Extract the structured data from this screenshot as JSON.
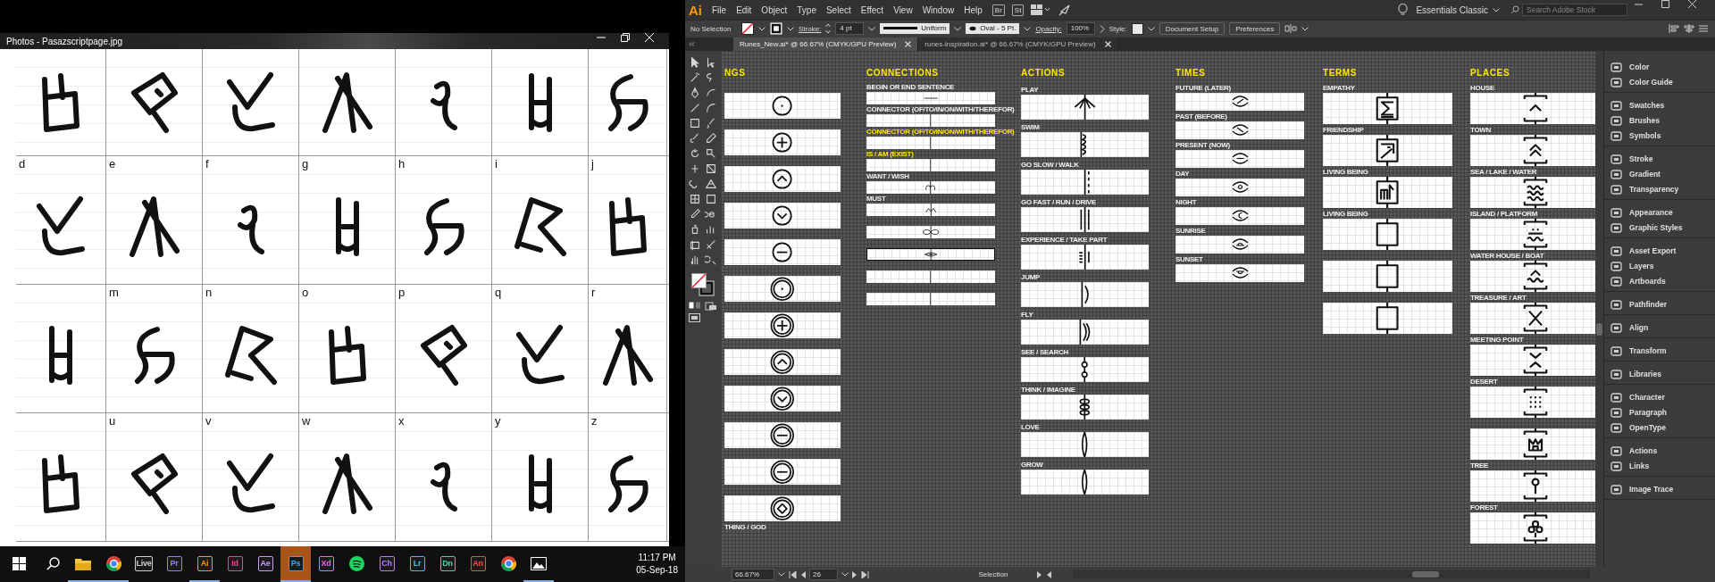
{
  "photos": {
    "title": "Photos - Pasazscriptpage.jpg",
    "letter_rows": [
      {
        "letters": [
          "d",
          "e",
          "f",
          "g",
          "h",
          "i",
          "j"
        ]
      },
      {
        "letters": [
          "m",
          "n",
          "o",
          "p",
          "q",
          "r"
        ]
      },
      {
        "letters": [
          "u",
          "v",
          "w",
          "x",
          "y",
          "z"
        ]
      }
    ]
  },
  "taskbar": {
    "items": [
      {
        "kind": "start",
        "open": false,
        "selected": false
      },
      {
        "kind": "search",
        "open": false,
        "selected": false
      },
      {
        "kind": "folder",
        "open": true,
        "selected": false
      },
      {
        "kind": "chrome",
        "open": true,
        "selected": false
      },
      {
        "kind": "tile",
        "label": "Live",
        "color": "#d0d0d0",
        "open": false,
        "selected": false
      },
      {
        "kind": "tile",
        "label": "Pr",
        "color": "#9a7cff",
        "open": false,
        "selected": false
      },
      {
        "kind": "tile",
        "label": "Ai",
        "color": "#ff9a00",
        "open": true,
        "selected": false
      },
      {
        "kind": "tile",
        "label": "Id",
        "color": "#ff3d93",
        "open": false,
        "selected": false
      },
      {
        "kind": "tile",
        "label": "Ae",
        "color": "#c99bff",
        "open": false,
        "selected": false
      },
      {
        "kind": "tile",
        "label": "Ps",
        "color": "#31a8ff",
        "open": true,
        "selected": true
      },
      {
        "kind": "tile",
        "label": "Xd",
        "color": "#ff61f6",
        "open": false,
        "selected": false
      },
      {
        "kind": "spotify",
        "open": false,
        "selected": false
      },
      {
        "kind": "tile",
        "label": "Ch",
        "color": "#b57cff",
        "open": false,
        "selected": false
      },
      {
        "kind": "tile",
        "label": "Lr",
        "color": "#31c5ff",
        "open": false,
        "selected": false
      },
      {
        "kind": "tile",
        "label": "Dn",
        "color": "#3fd6a6",
        "open": false,
        "selected": false
      },
      {
        "kind": "tile",
        "label": "An",
        "color": "#ff4a3d",
        "open": false,
        "selected": false
      },
      {
        "kind": "chrome",
        "open": false,
        "selected": false
      },
      {
        "kind": "photos",
        "open": true,
        "selected": false
      }
    ],
    "time": "11:17 PM",
    "date": "05-Sep-18"
  },
  "illustrator": {
    "logo": "Ai",
    "menu": [
      "File",
      "Edit",
      "Object",
      "Type",
      "Select",
      "Effect",
      "View",
      "Window",
      "Help"
    ],
    "bridge": "Br",
    "stock": "St",
    "workspace": "Essentials Classic",
    "search": {
      "placeholder": "Search Adobe Stock"
    },
    "control_bar": {
      "selection": "No Selection",
      "stroke_label": "Stroke:",
      "stroke_weight": "4 pt",
      "profile": "Uniform",
      "brush": "Oval - 5 Pt.",
      "opacity_label": "Opacity:",
      "opacity": "100%",
      "style_label": "Style:",
      "buttons": [
        "Document Setup",
        "Preferences"
      ]
    },
    "tabs": [
      {
        "title": "Runes_New.ai* @ 66.67% (CMYK/GPU Preview)",
        "selected": true
      },
      {
        "title": "runes-inspiration.ai* @ 66.67% (CMYK/GPU Preview)",
        "selected": false
      }
    ],
    "columns": [
      {
        "heading": "NGS",
        "rows": [
          {
            "kind": "ring-dot"
          },
          {
            "kind": "ring-plus"
          },
          {
            "kind": "ring-up"
          },
          {
            "kind": "ring-down"
          },
          {
            "kind": "ring-minus"
          },
          {
            "kind": "double-ring-dot"
          },
          {
            "kind": "double-ring-plus"
          },
          {
            "kind": "double-ring-up"
          },
          {
            "kind": "double-ring-down"
          },
          {
            "kind": "double-ring-minus"
          },
          {
            "kind": "double-ring-minus"
          },
          {
            "kind": "double-ring-diamond"
          },
          {
            "label": "THING / GOD"
          }
        ]
      },
      {
        "heading": "CONNECTIONS",
        "rows": [
          {
            "label": "BEGIN OR END SENTENCE",
            "kind": "bar",
            "highlighted": false,
            "selected": false
          },
          {
            "label": "CONNECTOR (OF/TO/IN/ON/WITH/THEREFOR)",
            "kind": "stem",
            "highlighted": false,
            "selected": false
          },
          {
            "label": "CONNECTOR (OF/TO/IN/ON/WITH/THEREFOR)",
            "kind": "stem",
            "highlighted": true,
            "selected": false
          },
          {
            "label": "IS / AM (EXIST)",
            "kind": "stem",
            "highlighted": true,
            "selected": false
          },
          {
            "label": "WANT / WISH",
            "kind": "want",
            "highlighted": false,
            "selected": false
          },
          {
            "label": "MUST",
            "kind": "must",
            "highlighted": false,
            "selected": false
          },
          {
            "kind": "bow",
            "selected": false
          },
          {
            "kind": "eye-stem",
            "selected": true
          },
          {
            "kind": "stem",
            "selected": false
          },
          {
            "kind": "stem",
            "selected": false
          }
        ]
      },
      {
        "heading": "ACTIONS",
        "rows": [
          {
            "label": "PLAY",
            "kind": "play"
          },
          {
            "label": "SWIM",
            "kind": "wave"
          },
          {
            "label": "GO SLOW / WALK",
            "kind": "dashed"
          },
          {
            "label": "GO FAST / RUN / DRIVE",
            "kind": "triple"
          },
          {
            "label": "EXPERIENCE / TAKE PART",
            "kind": "bars"
          },
          {
            "label": "JUMP",
            "kind": "paren"
          },
          {
            "label": "FLY",
            "kind": "dparen"
          },
          {
            "label": "SEE / SEARCH",
            "kind": "beads"
          },
          {
            "label": "THINK / IMAGINE",
            "kind": "ovals"
          },
          {
            "label": "LOVE",
            "kind": "lens"
          },
          {
            "label": "GROW",
            "kind": "lens"
          }
        ]
      },
      {
        "heading": "TIMES",
        "rows": [
          {
            "label": "FUTURE (LATER)",
            "kind": "eye-slash"
          },
          {
            "label": "PAST (BEFORE)",
            "kind": "eye-backslash"
          },
          {
            "label": "PRESENT (NOW)",
            "kind": "eye-minus"
          },
          {
            "label": "DAY",
            "kind": "eye-dot"
          },
          {
            "label": "NIGHT",
            "kind": "eye-moon"
          },
          {
            "label": "SUNRISE",
            "kind": "eye-rise"
          },
          {
            "label": "SUNSET",
            "kind": "eye-set"
          }
        ]
      },
      {
        "heading": "TERMS",
        "rows": [
          {
            "label": "EMPATHY",
            "kind": "box-sigma"
          },
          {
            "label": "FRIENDSHIP",
            "kind": "box-hook"
          },
          {
            "label": "LIVING BEING",
            "kind": "box-m"
          },
          {
            "label": "LIVING BEING",
            "kind": "box"
          },
          {
            "kind": "box"
          },
          {
            "kind": "box"
          }
        ]
      },
      {
        "heading": "PLACES",
        "rows": [
          {
            "label": "HOUSE",
            "kind": "bracket-up"
          },
          {
            "label": "TOWN",
            "kind": "bracket-double-up"
          },
          {
            "label": "SEA / LAKE / WATER",
            "kind": "bracket-waves"
          },
          {
            "label": "ISLAND / PLATFORM",
            "kind": "bracket-island"
          },
          {
            "label": "WATER HOUSE / BOAT",
            "kind": "bracket-boat"
          },
          {
            "label": "TREASURE / ART",
            "kind": "bracket-x"
          },
          {
            "label": "MEETING POINT",
            "kind": "bracket-meet"
          },
          {
            "label": "DESERT",
            "kind": "bracket-dots"
          },
          {
            "kind": "bracket-crown"
          },
          {
            "label": "TREE",
            "kind": "bracket-key"
          },
          {
            "label": "FOREST",
            "kind": "bracket-trees"
          }
        ]
      }
    ],
    "panels": [
      [
        "Color",
        "Color Guide"
      ],
      [
        "Swatches",
        "Brushes",
        "Symbols"
      ],
      [
        "Stroke",
        "Gradient",
        "Transparency"
      ],
      [
        "Appearance",
        "Graphic Styles"
      ],
      [
        "Asset Export",
        "Layers",
        "Artboards"
      ],
      [
        "Pathfinder"
      ],
      [
        "Align"
      ],
      [
        "Transform"
      ],
      [
        "Libraries"
      ],
      [
        "Character",
        "Paragraph",
        "OpenType"
      ],
      [
        "Actions",
        "Links"
      ],
      [
        "Image Trace"
      ]
    ],
    "status": {
      "zoom": "66.67%",
      "artboard": "26",
      "tool": "Selection"
    }
  }
}
